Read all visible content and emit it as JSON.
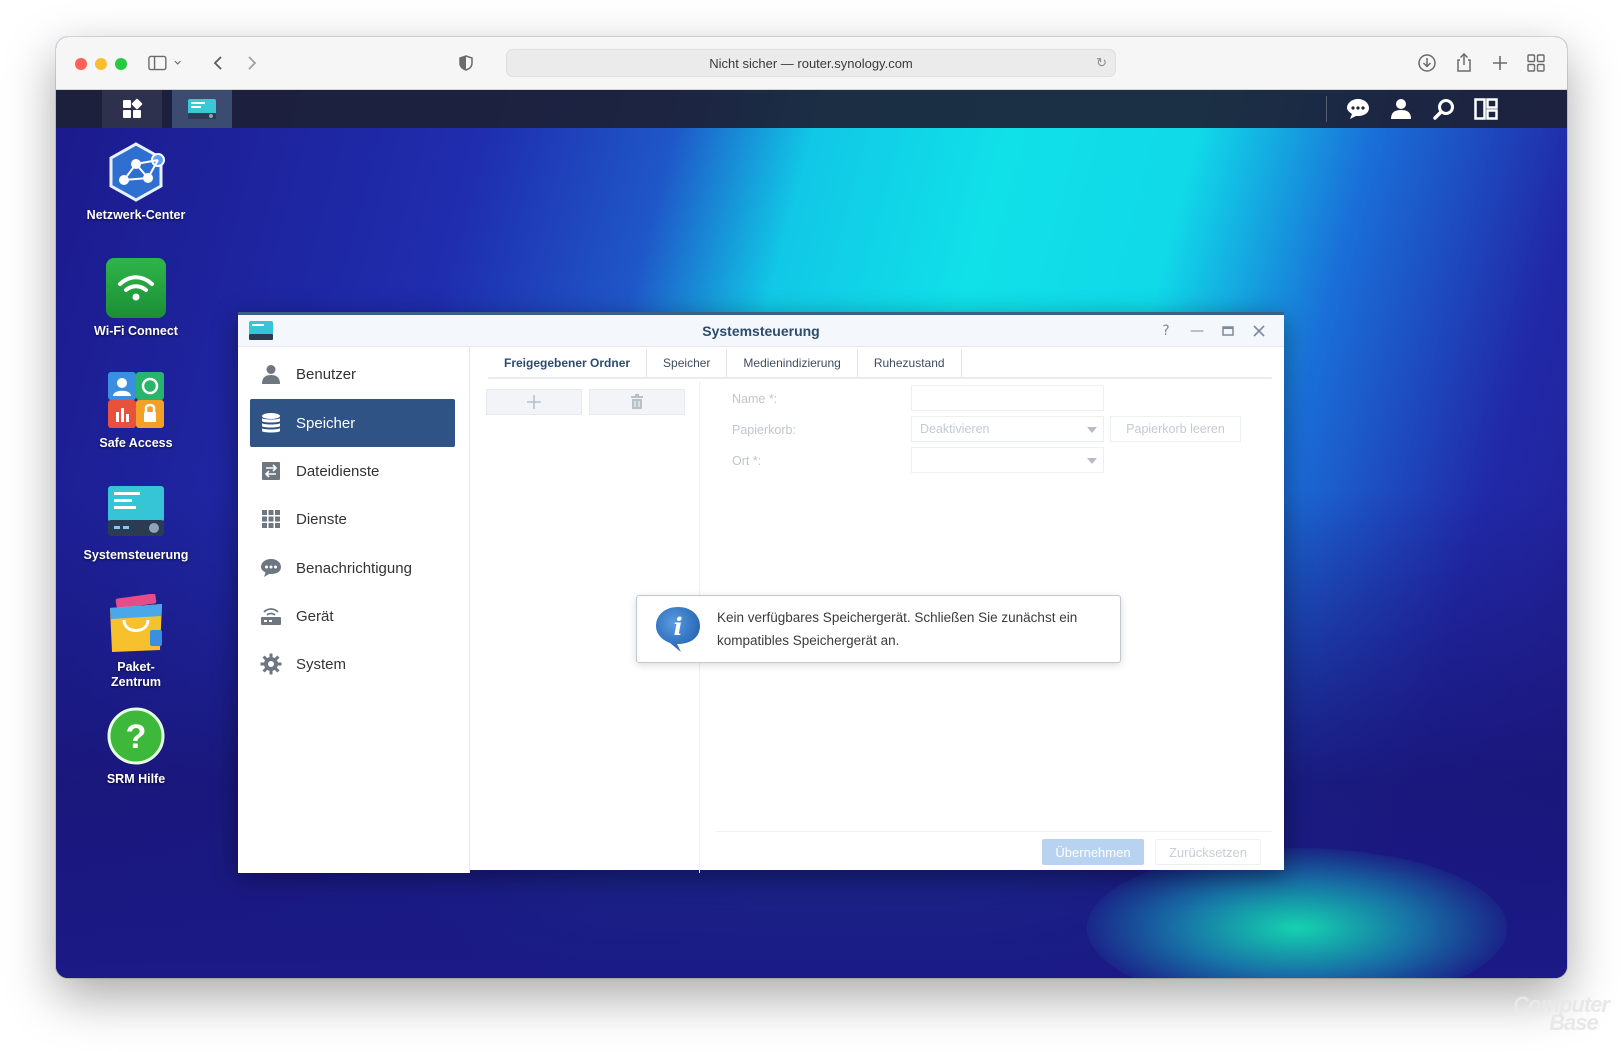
{
  "browser": {
    "url": "Nicht sicher — router.synology.com"
  },
  "desktop": {
    "icons": [
      {
        "label": "Netzwerk-Center"
      },
      {
        "label": "Wi-Fi Connect"
      },
      {
        "label": "Safe Access"
      },
      {
        "label": "Systemsteuerung"
      },
      {
        "label": "Paket-\nZentrum"
      },
      {
        "label": "SRM Hilfe"
      }
    ]
  },
  "window": {
    "title": "Systemsteuerung",
    "sidebar": [
      {
        "label": "Benutzer",
        "icon": "user-icon"
      },
      {
        "label": "Speicher",
        "icon": "database-icon",
        "active": true
      },
      {
        "label": "Dateidienste",
        "icon": "file-services-icon"
      },
      {
        "label": "Dienste",
        "icon": "grid-icon"
      },
      {
        "label": "Benachrichtigung",
        "icon": "chat-bubble-icon"
      },
      {
        "label": "Gerät",
        "icon": "router-icon"
      },
      {
        "label": "System",
        "icon": "gear-icon"
      }
    ],
    "tabs": [
      {
        "label": "Freigegebener Ordner",
        "active": true
      },
      {
        "label": "Speicher"
      },
      {
        "label": "Medienindizierung"
      },
      {
        "label": "Ruhezustand"
      }
    ],
    "form": {
      "name_label": "Name *:",
      "name_value": "",
      "trash_label": "Papierkorb:",
      "trash_value": "Deaktivieren",
      "trash_button": "Papierkorb leeren",
      "location_label": "Ort *:",
      "location_value": ""
    },
    "buttons": {
      "apply": "Übernehmen",
      "reset": "Zurücksetzen"
    },
    "message": "Kein verfügbares Speichergerät. Schließen Sie zunächst ein kompatibles Speichergerät an."
  },
  "watermark": {
    "line1": "Computer",
    "line2": "Base"
  },
  "colors": {
    "accent": "#2e5384",
    "title": "#2d4b6e"
  }
}
